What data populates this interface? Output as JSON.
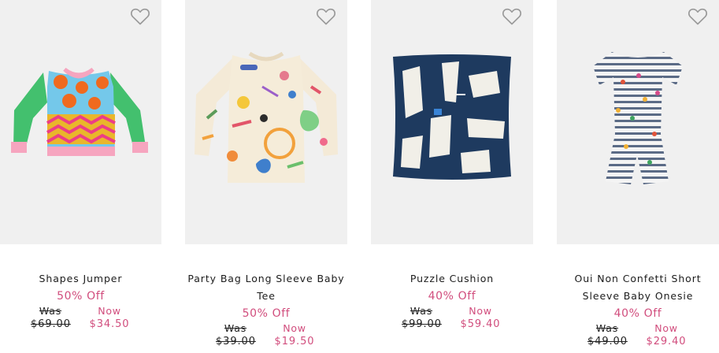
{
  "products": [
    {
      "name": "Shapes Jumper",
      "discount": "50% Off",
      "was_label": "Was",
      "was_price": "$69.00",
      "now_label": "Now",
      "now_price": "$34.50",
      "wishlist_icon": "heart-outline-icon"
    },
    {
      "name": "Party Bag Long Sleeve Baby Tee",
      "discount": "50% Off",
      "was_label": "Was",
      "was_price": "$39.00",
      "now_label": "Now",
      "now_price": "$19.50",
      "wishlist_icon": "heart-outline-icon"
    },
    {
      "name": "Puzzle Cushion",
      "discount": "40% Off",
      "was_label": "Was",
      "was_price": "$99.00",
      "now_label": "Now",
      "now_price": "$59.40",
      "wishlist_icon": "heart-outline-icon"
    },
    {
      "name": "Oui Non Confetti Short Sleeve Baby Onesie",
      "discount": "40% Off",
      "was_label": "Was",
      "was_price": "$49.00",
      "now_label": "Now",
      "now_price": "$29.40",
      "wishlist_icon": "heart-outline-icon"
    }
  ],
  "colors": {
    "accent_pink": "#d14d7d",
    "image_bg": "#f0f0f0",
    "text": "#1c1c1c"
  }
}
